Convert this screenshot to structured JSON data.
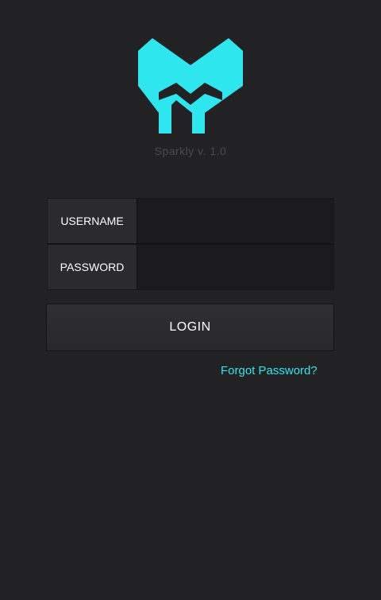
{
  "app": {
    "version_text": "Sparkly v. 1.0",
    "accent_color": "#2ee6ee",
    "logo_icon": "m-shield-logo"
  },
  "login_form": {
    "username_label": "USERNAME",
    "username_value": "",
    "password_label": "PASSWORD",
    "password_value": "",
    "login_label": "LOGIN",
    "forgot_label": "Forgot Password?"
  }
}
